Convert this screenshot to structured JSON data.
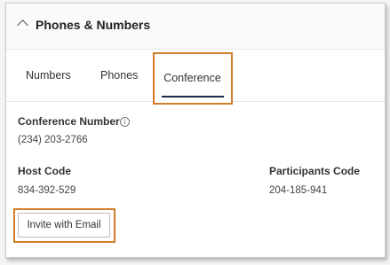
{
  "section": {
    "title": "Phones & Numbers"
  },
  "tabs": [
    {
      "label": "Numbers"
    },
    {
      "label": "Phones"
    },
    {
      "label": "Conference",
      "active": true
    }
  ],
  "conference": {
    "number_label": "Conference Number",
    "number_value": "(234) 203-2766",
    "host_code_label": "Host Code",
    "host_code_value": "834-392-529",
    "participants_code_label": "Participants Code",
    "participants_code_value": "204-185-941"
  },
  "actions": {
    "invite_label": "Invite with Email"
  },
  "colors": {
    "highlight": "#d17d29",
    "active_tab_underline": "#1d2a44"
  },
  "icons": {
    "collapse": "chevron-up-icon",
    "info": "info-icon"
  }
}
